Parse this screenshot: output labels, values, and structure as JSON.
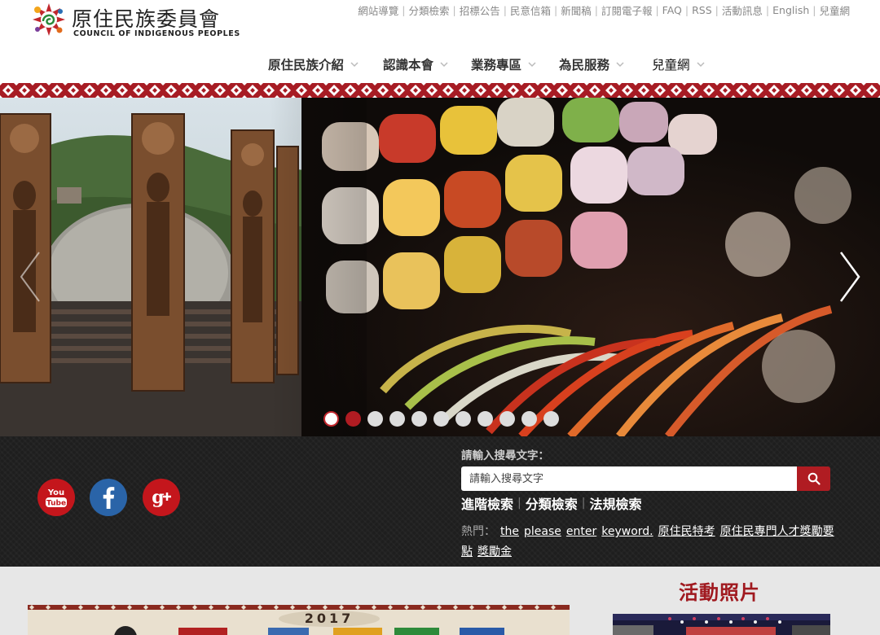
{
  "logo": {
    "name_cn": "原住民族委員會",
    "name_en": "COUNCIL OF INDIGENOUS PEOPLES"
  },
  "top_links": [
    "網站導覽",
    "分類檢索",
    "招標公告",
    "民意信箱",
    "新聞稿",
    "訂閱電子報",
    "FAQ",
    "RSS",
    "活動訊息",
    "English",
    "兒童網"
  ],
  "main_nav": [
    {
      "label": "原住民族介紹"
    },
    {
      "label": "認識本會"
    },
    {
      "label": "業務專區"
    },
    {
      "label": "為民服務"
    },
    {
      "label": "兒童網"
    }
  ],
  "carousel": {
    "slide_count": 11,
    "active_index": 0
  },
  "search": {
    "label": "請輸入搜尋文字：",
    "placeholder": "請輸入搜尋文字",
    "advanced_links": [
      "進階檢索",
      "分類檢索",
      "法規檢索"
    ],
    "hot_label": "熱門：",
    "hot_keywords": [
      "the",
      "please",
      "enter",
      "keyword.",
      "原住民特考",
      "原住民專門人才獎勵要點",
      "獎勵金"
    ]
  },
  "social": [
    {
      "name": "YouTube",
      "icon": "youtube-icon"
    },
    {
      "name": "Facebook",
      "icon": "facebook-icon"
    },
    {
      "name": "Google+",
      "icon": "google-plus-icon"
    }
  ],
  "activity": {
    "title": "活動照片"
  },
  "banner": {
    "year": "2017"
  },
  "colors": {
    "brand_red": "#b01c22",
    "dark_band": "#1e1e1e",
    "lower_bg": "#e7e7e7",
    "title_red": "#a0191f"
  }
}
